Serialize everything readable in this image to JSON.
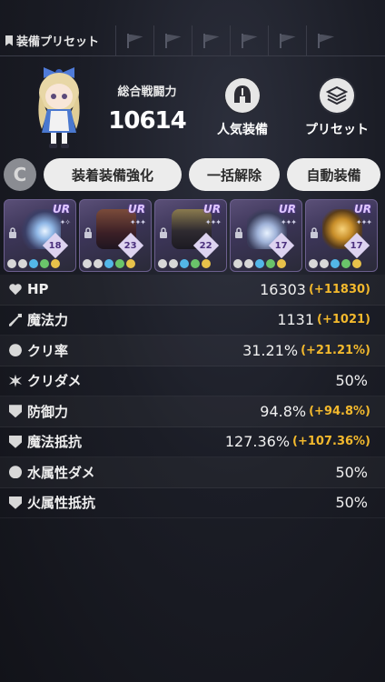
{
  "header": {
    "title": "装備プリセット"
  },
  "power": {
    "label": "総合戦闘力",
    "value": "10614"
  },
  "actions": {
    "popular_label": "人気装備",
    "preset_label": "プリセット"
  },
  "buttons": {
    "refresh_glyph": "C",
    "enhance_label": "装着装備強化",
    "unequip_all_label": "一括解除",
    "auto_equip_label": "自動装備"
  },
  "equipment": [
    {
      "rarity": "UR",
      "level": "18",
      "stars": "✦✧"
    },
    {
      "rarity": "UR",
      "level": "23",
      "stars": "✦✦✦"
    },
    {
      "rarity": "UR",
      "level": "22",
      "stars": "✦✦✦"
    },
    {
      "rarity": "UR",
      "level": "17",
      "stars": "✦✦✦"
    },
    {
      "rarity": "UR",
      "level": "17",
      "stars": "✦✦✦"
    }
  ],
  "stats": [
    {
      "name": "HP",
      "value": "16303",
      "bonus": "(+11830)",
      "icon": "heart-icon"
    },
    {
      "name": "魔法力",
      "value": "1131",
      "bonus": "(+1021)",
      "icon": "wand-icon"
    },
    {
      "name": "クリ率",
      "value": "31.21%",
      "bonus": "(+21.21%)",
      "icon": "crit-icon"
    },
    {
      "name": "クリダメ",
      "value": "50%",
      "bonus": "",
      "icon": "burst-icon"
    },
    {
      "name": "防御力",
      "value": "94.8%",
      "bonus": "(+94.8%)",
      "icon": "shield-icon"
    },
    {
      "name": "魔法抵抗",
      "value": "127.36%",
      "bonus": "(+107.36%)",
      "icon": "magic-shield-icon"
    },
    {
      "name": "水属性ダメ",
      "value": "50%",
      "bonus": "",
      "icon": "water-icon"
    },
    {
      "name": "火属性抵抗",
      "value": "50%",
      "bonus": "",
      "icon": "fire-shield-icon"
    }
  ],
  "colors": {
    "bonus": "#f3b92d",
    "card_border": "#6c5f8e",
    "pill_bg": "#ececec"
  }
}
